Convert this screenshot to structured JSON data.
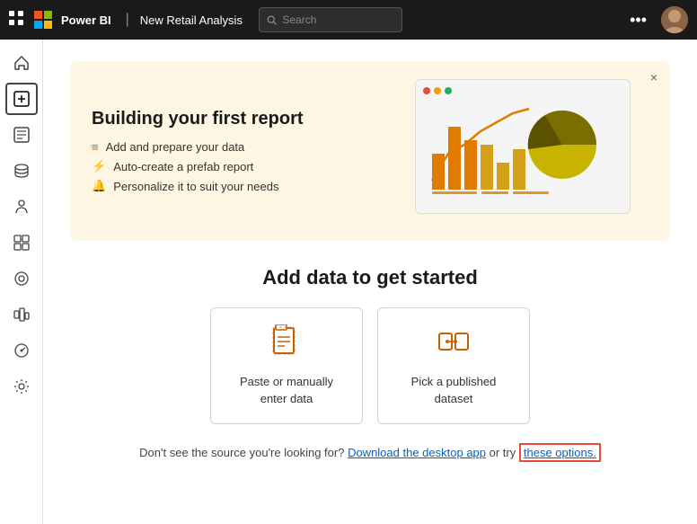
{
  "topbar": {
    "powerbi_label": "Power BI",
    "report_name": "New Retail Analysis",
    "search_placeholder": "Search",
    "more_icon": "•••",
    "divider": "|"
  },
  "sidebar": {
    "items": [
      {
        "icon": "⌂",
        "label": "Home",
        "active": false
      },
      {
        "icon": "＋",
        "label": "Create",
        "active": true
      },
      {
        "icon": "◻",
        "label": "Browse",
        "active": false
      },
      {
        "icon": "⬡",
        "label": "Data hub",
        "active": false
      },
      {
        "icon": "👤",
        "label": "Apps",
        "active": false
      },
      {
        "icon": "⧉",
        "label": "Workspaces",
        "active": false
      },
      {
        "icon": "⊙",
        "label": "Learn",
        "active": false
      },
      {
        "icon": "▣",
        "label": "Deployment",
        "active": false
      },
      {
        "icon": "⊕",
        "label": "Metrics",
        "active": false
      },
      {
        "icon": "⚙",
        "label": "Settings",
        "active": false
      }
    ]
  },
  "banner": {
    "title": "Building your first report",
    "close_icon": "×",
    "steps": [
      {
        "icon": "≡",
        "text": "Add and prepare your data"
      },
      {
        "icon": "⚡",
        "text": "Auto-create a prefab report"
      },
      {
        "icon": "🔔",
        "text": "Personalize it to suit your needs"
      }
    ]
  },
  "add_data": {
    "title": "Add data to get started",
    "cards": [
      {
        "icon": "📋",
        "label": "Paste or manually enter data"
      },
      {
        "icon": "🏗",
        "label": "Pick a published dataset"
      }
    ]
  },
  "footer": {
    "text_before": "Don't see the source you're looking for?",
    "link1_label": "Download the desktop app",
    "text_middle": " or try ",
    "link2_label": "these options."
  }
}
